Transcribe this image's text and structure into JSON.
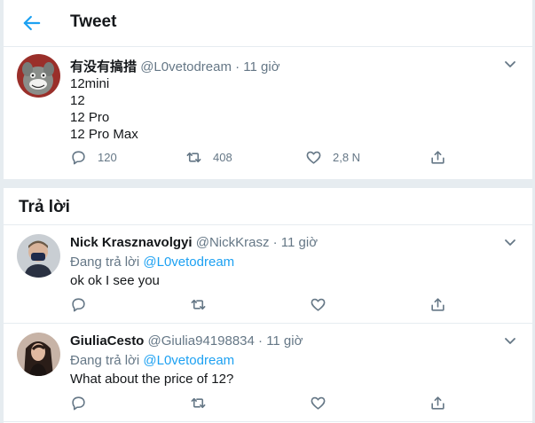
{
  "header": {
    "title": "Tweet"
  },
  "main_tweet": {
    "name": "有没有搞措",
    "handle": "@L0vetodream",
    "time": " · 11 giờ",
    "lines": [
      "12mini",
      "12",
      "12 Pro",
      "12 Pro Max"
    ],
    "replies": "120",
    "retweets": "408",
    "likes": "2,8 N"
  },
  "replies_section": {
    "title": "Trả lời"
  },
  "replies": [
    {
      "name": "Nick Krasznavolgyi",
      "handle": "@NickKrasz",
      "time": " · 11 giờ",
      "replying_prefix": "Đang trả lời ",
      "replying_to": "@L0vetodream",
      "text": "ok ok I see you"
    },
    {
      "name": "GiuliaCesto",
      "handle": "@Giulia94198834",
      "time": " · 11 giờ",
      "replying_prefix": "Đang trả lời ",
      "replying_to": "@L0vetodream",
      "text": "What about the price of 12?"
    }
  ],
  "colors": {
    "accent": "#1da1f2",
    "muted": "#657786",
    "border": "#e6ecf0"
  }
}
